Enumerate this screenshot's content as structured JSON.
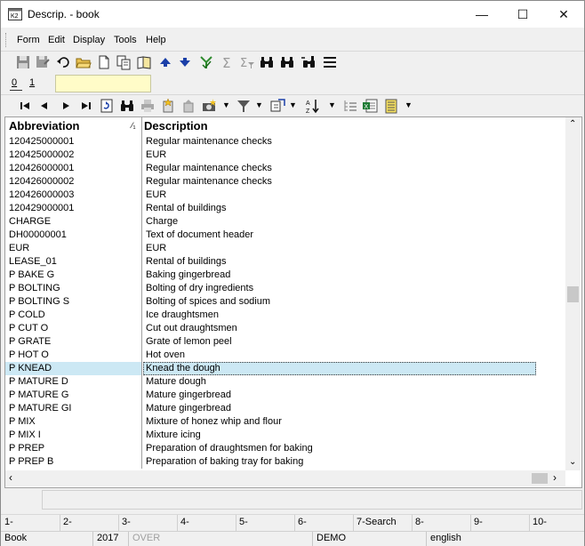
{
  "window": {
    "title": "Descrip. - book",
    "minimize": "—",
    "maximize": "☐",
    "close": "✕"
  },
  "menu": {
    "items": [
      "Form",
      "Edit",
      "Display",
      "Tools",
      "Help"
    ]
  },
  "toolbar1": {
    "icons": [
      "save-icon",
      "save-as-icon",
      "undo-icon",
      "open-folder-icon",
      "new-document-icon",
      "copy-icon",
      "book-icon",
      "arrow-up-icon",
      "arrow-down-icon",
      "tree-check-icon",
      "sum-icon",
      "sum-filter-icon",
      "binoculars-icon",
      "binoculars-next-icon",
      "binoculars-replace-icon",
      "menu-lines-icon"
    ]
  },
  "tabs": {
    "items": [
      "0",
      "1"
    ],
    "active": "0",
    "input_value": ""
  },
  "toolbar2": {
    "icons": [
      "first-record-icon",
      "prev-record-icon",
      "next-record-icon",
      "last-record-icon",
      "refresh-icon",
      "find-icon",
      "print-icon",
      "new-record-icon",
      "delete-record-icon",
      "camera-icon",
      "filter-icon",
      "export-icon",
      "sort-az-icon",
      "outline-icon",
      "excel-icon",
      "notes-icon"
    ]
  },
  "grid": {
    "columns": [
      "Abbreviation",
      "Description"
    ],
    "sort_marker": "⁄₁",
    "selected_index": 17,
    "rows": [
      [
        "120425000001",
        "Regular maintenance checks"
      ],
      [
        "120425000002",
        "EUR"
      ],
      [
        "120426000001",
        "Regular maintenance checks"
      ],
      [
        "120426000002",
        "Regular maintenance checks"
      ],
      [
        "120426000003",
        "EUR"
      ],
      [
        "120429000001",
        "Rental of buildings"
      ],
      [
        "CHARGE",
        "Charge"
      ],
      [
        "DH00000001",
        "Text of document header"
      ],
      [
        "EUR",
        "EUR"
      ],
      [
        "LEASE_01",
        "Rental of buildings"
      ],
      [
        "P BAKE G",
        "Baking gingerbread"
      ],
      [
        "P BOLTING",
        "Bolting of dry ingredients"
      ],
      [
        "P BOLTING S",
        "Bolting of spices and sodium"
      ],
      [
        "P COLD",
        "Ice draughtsmen"
      ],
      [
        "P CUT O",
        "Cut out draughtsmen"
      ],
      [
        "P GRATE",
        "Grate of lemon peel"
      ],
      [
        "P HOT O",
        "Hot oven"
      ],
      [
        "P KNEAD",
        "Knead the dough"
      ],
      [
        "P MATURE D",
        "Mature dough"
      ],
      [
        "P MATURE G",
        "Mature gingerbread"
      ],
      [
        "P MATURE GI",
        "Mature gingerbread"
      ],
      [
        "P MIX",
        "Mixture of honez whip and flour"
      ],
      [
        "P MIX I",
        "Mixture icing"
      ],
      [
        "P PREP",
        "Preparation of draughtsmen for baking"
      ],
      [
        "P PREP B",
        "Preparation of baking tray for baking"
      ]
    ]
  },
  "fkeys": [
    "1-",
    "2-",
    "3-",
    "4-",
    "5-",
    "6-",
    "7-Search",
    "8-",
    "9-",
    "10-"
  ],
  "status": {
    "table": "Book",
    "year": "2017",
    "mode": "OVER",
    "database": "DEMO",
    "language": "english"
  },
  "colors": {
    "selection": "#cce8f4",
    "tab_input": "#fffcc8",
    "arrow_blue": "#1a3fa8",
    "icon_green": "#2e8b2e"
  }
}
